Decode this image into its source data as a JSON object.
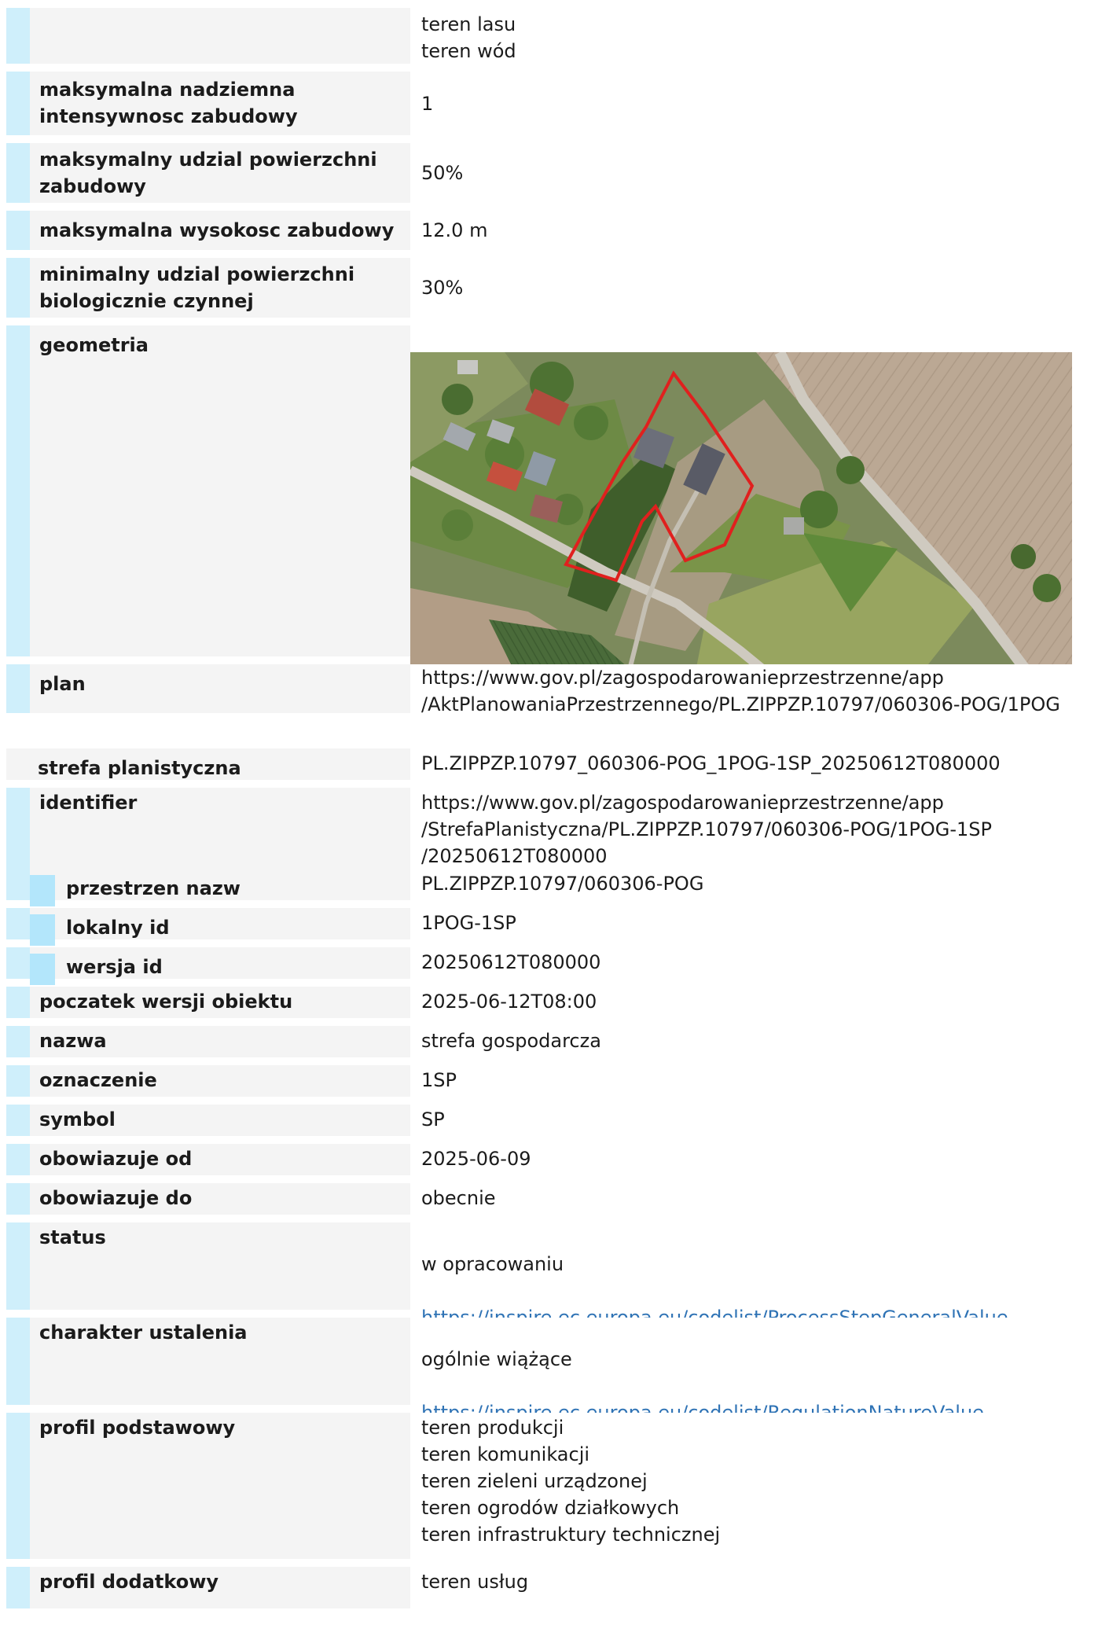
{
  "block1": {
    "rows": [
      {
        "label": "",
        "value": "teren lasu\nteren wód"
      },
      {
        "label": "maksymalna nadziemna\nintensywnosc zabudowy",
        "value": "1"
      },
      {
        "label": "maksymalny udzial powierzchni\nzabudowy",
        "value": "50%"
      },
      {
        "label": "maksymalna wysokosc zabudowy",
        "value": "12.0 m"
      },
      {
        "label": "minimalny udzial powierzchni\nbiologicznie czynnej",
        "value": "30%"
      },
      {
        "label": "geometria",
        "value": ""
      },
      {
        "label": "plan",
        "value": "https://www.gov.pl/zagospodarowanieprzestrzenne/app\n/AktPlanowaniaPrzestrzennego/PL.ZIPPZP.10797/060306-POG/1POG"
      }
    ]
  },
  "block2": {
    "header_label": "strefa planistyczna",
    "header_value": "PL.ZIPPZP.10797_060306-POG_1POG-1SP_20250612T080000",
    "identifier_label": "identifier",
    "identifier_value": "https://www.gov.pl/zagospodarowanieprzestrzenne/app\n/StrefaPlanistyczna/PL.ZIPPZP.10797/060306-POG/1POG-1SP\n/20250612T080000",
    "sub": [
      {
        "label": "przestrzen nazw",
        "value": "PL.ZIPPZP.10797/060306-POG"
      },
      {
        "label": "lokalny id",
        "value": "1POG-1SP"
      },
      {
        "label": "wersja id",
        "value": "20250612T080000"
      }
    ],
    "rows": [
      {
        "label": "poczatek wersji obiektu",
        "value": "2025-06-12T08:00"
      },
      {
        "label": "nazwa",
        "value": "strefa gospodarcza"
      },
      {
        "label": "oznaczenie",
        "value": "1SP"
      },
      {
        "label": "symbol",
        "value": "SP"
      },
      {
        "label": "obowiazuje od",
        "value": "2025-06-09"
      },
      {
        "label": "obowiazuje do",
        "value": "obecnie"
      }
    ],
    "status_label": "status",
    "status_text": "w opracowaniu",
    "status_link": "https://inspire.ec.europa.eu/codelist/ProcessStepGeneralValue\n/elaboration",
    "charakter_label": "charakter ustalenia",
    "charakter_text": "ogólnie wiążące",
    "charakter_link": "https://inspire.ec.europa.eu/codelist/RegulationNatureValue\n/generallyBinding",
    "profil_podstawowy_label": "profil podstawowy",
    "profil_podstawowy_value": "teren produkcji\nteren komunikacji\nteren zieleni urządzonej\nteren ogrodów działkowych\nteren infrastruktury technicznej",
    "profil_dodatkowy_label": "profil dodatkowy",
    "profil_dodatkowy_value": "teren usług"
  },
  "colors": {
    "bar_light": "#cfeffb",
    "bar_mid": "#b3e6fb",
    "label_bg": "#f4f4f4",
    "link": "#2f73b5",
    "parcel_outline": "#e0201e"
  }
}
